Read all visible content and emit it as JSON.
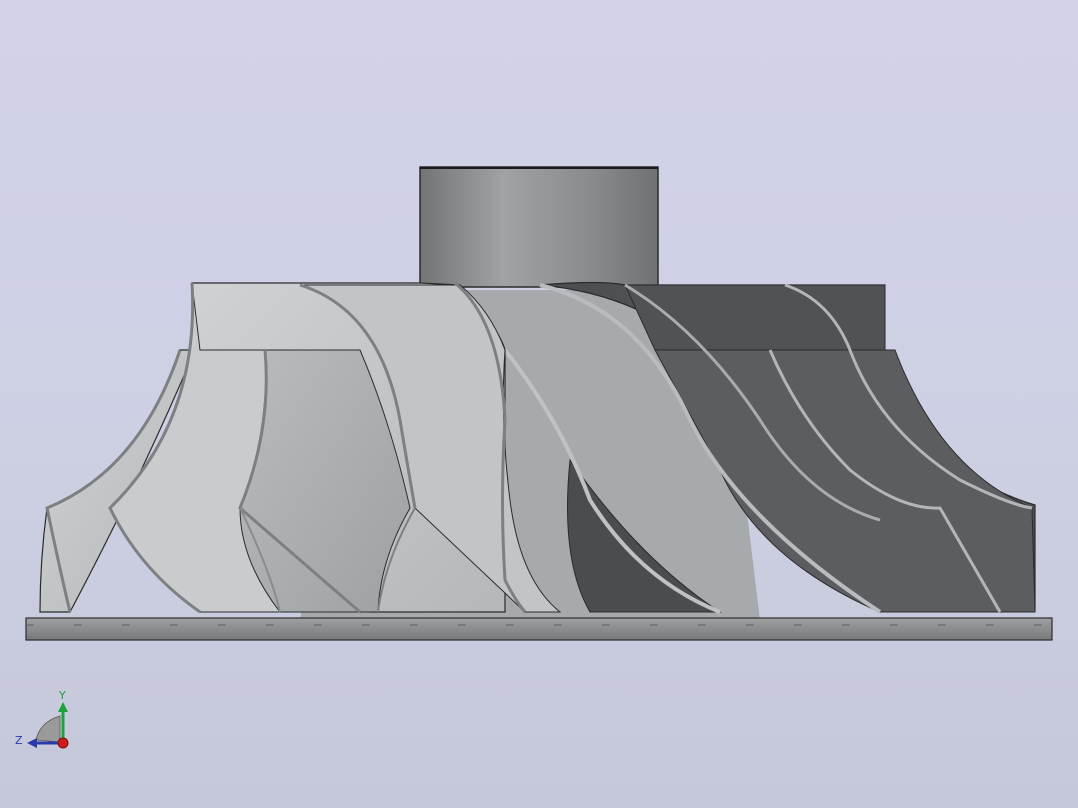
{
  "viewport": {
    "background_top": "#d2d3e9",
    "background_bottom": "#c5c8d9"
  },
  "model": {
    "hub_color": "#8c8e91",
    "blade_light_color": "#c4c7c9",
    "blade_dark_color": "#55575b",
    "base_color": "#8a8c8e"
  },
  "triad": {
    "y_label": "Y",
    "z_label": "Z",
    "y_color": "#1aa33a",
    "z_color": "#2a3aa8",
    "x_color": "#d01b1b"
  }
}
